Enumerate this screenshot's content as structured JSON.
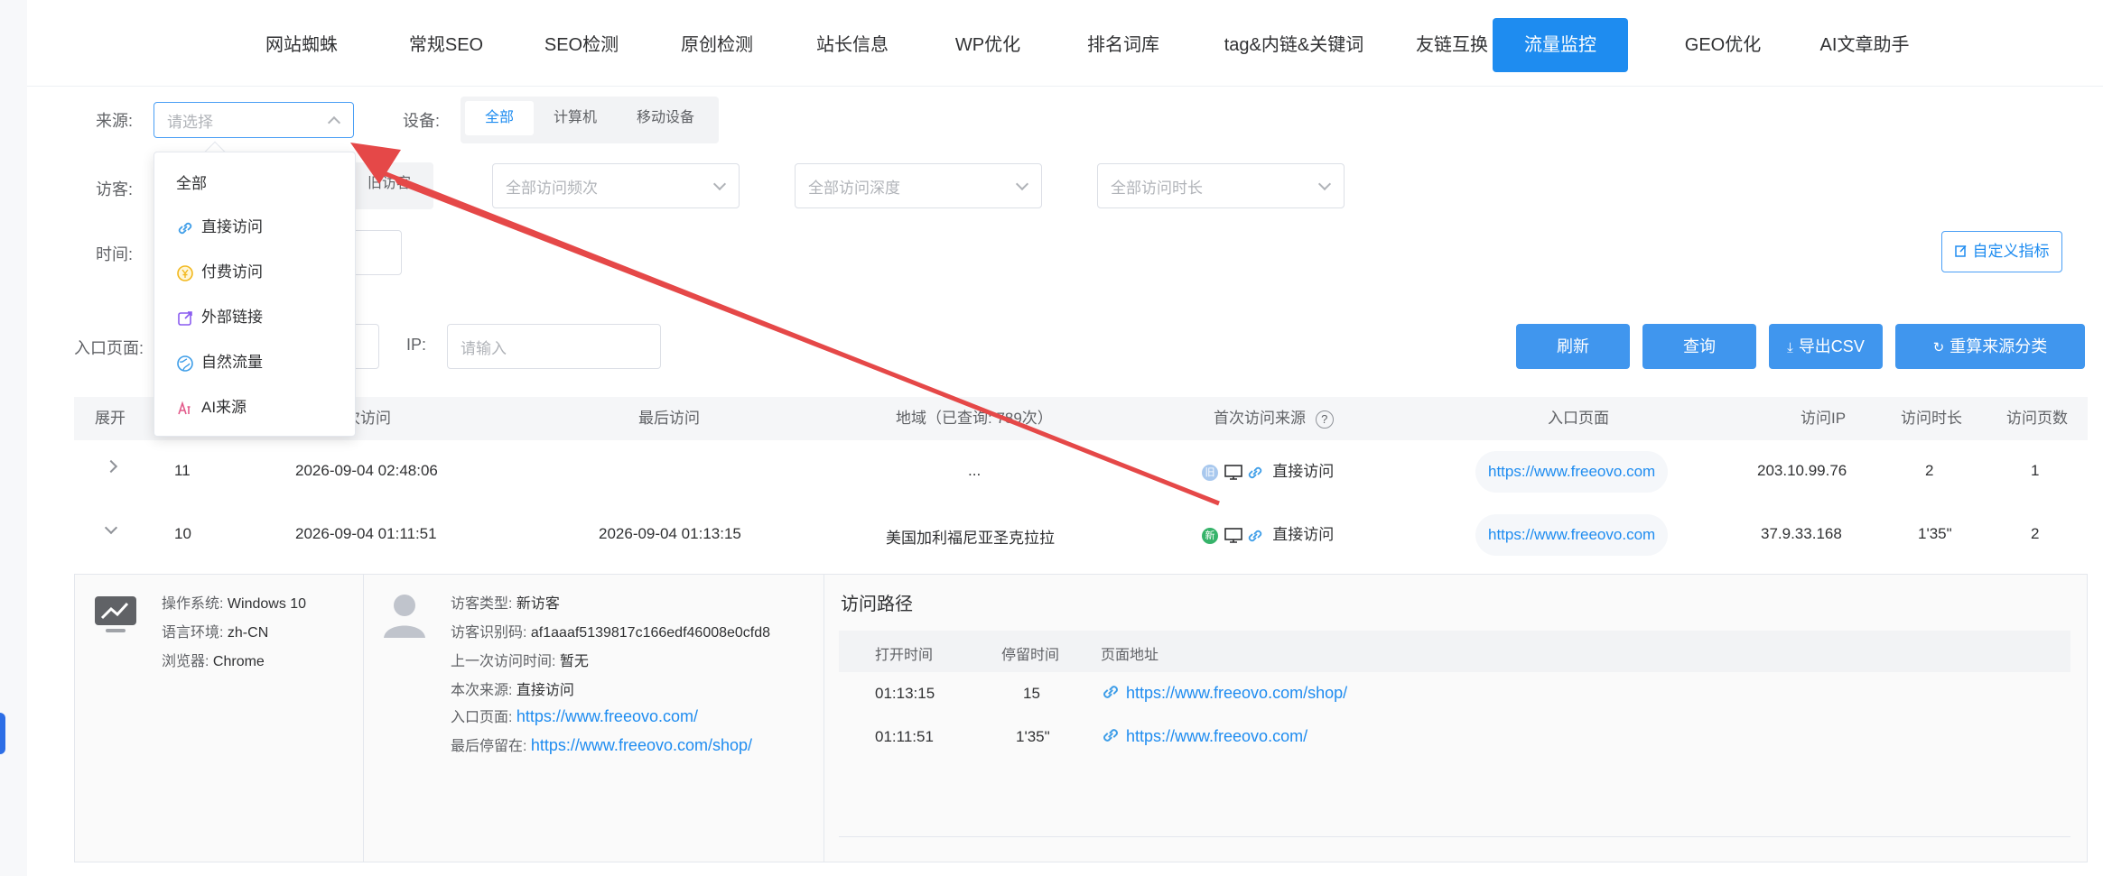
{
  "nav": {
    "items": [
      "网站蜘蛛",
      "常规SEO",
      "SEO检测",
      "原创检测",
      "站长信息",
      "WP优化",
      "排名词库",
      "tag&内链&关键词",
      "友链互换",
      "流量监控",
      "GEO优化",
      "AI文章助手"
    ],
    "active_index": 9
  },
  "filters": {
    "source_label": "来源:",
    "source_placeholder": "请选择",
    "device_label": "设备:",
    "device_options": [
      "全部",
      "计算机",
      "移动设备"
    ],
    "visitor_label": "访客:",
    "visitor_old": "旧访客",
    "freq_placeholder": "全部访问频次",
    "depth_placeholder": "全部访问深度",
    "duration_placeholder": "全部访问时长",
    "time_label": "时间:",
    "custom_metric": "自定义指标",
    "entry_label": "入口页面:",
    "ip_label": "IP:",
    "ip_placeholder": "请输入"
  },
  "buttons": {
    "refresh": "刷新",
    "query": "查询",
    "export": "导出CSV",
    "reclassify": "重算来源分类"
  },
  "dropdown": {
    "items": [
      {
        "label": "全部",
        "icon": ""
      },
      {
        "label": "直接访问",
        "icon": "link-icon"
      },
      {
        "label": "付费访问",
        "icon": "yen-coin-icon"
      },
      {
        "label": "外部链接",
        "icon": "external-link-icon"
      },
      {
        "label": "自然流量",
        "icon": "globe-icon"
      },
      {
        "label": "AI来源",
        "icon": "ai-icon"
      }
    ]
  },
  "table": {
    "headers": {
      "expand": "展开",
      "first_visit": "次访问",
      "last_visit": "最后访问",
      "region": "地域（已查询: 789次）",
      "first_source": "首次访问来源",
      "entry_page": "入口页面",
      "ip": "访问IP",
      "duration": "访问时长",
      "pages": "访问页数"
    },
    "rows": [
      {
        "id": "11",
        "first": "2026-09-04 02:48:06",
        "last": "",
        "region": "...",
        "source": "直接访问",
        "entry": "https://www.freeovo.com",
        "ip": "203.10.99.76",
        "duration": "2",
        "pages": "1",
        "badge": "旧"
      },
      {
        "id": "10",
        "first": "2026-09-04 01:11:51",
        "last": "2026-09-04 01:13:15",
        "region": "美国加利福尼亚圣克拉拉",
        "source": "直接访问",
        "entry": "https://www.freeovo.com",
        "ip": "37.9.33.168",
        "duration": "1'35\"",
        "pages": "2",
        "badge": "新"
      }
    ]
  },
  "detail": {
    "os": {
      "label": "操作系统:",
      "value": "Windows 10"
    },
    "lang": {
      "label": "语言环境:",
      "value": "zh-CN"
    },
    "browser": {
      "label": "浏览器:",
      "value": "Chrome"
    },
    "visitor_type": {
      "label": "访客类型:",
      "value": "新访客"
    },
    "visitor_id": {
      "label": "访客识别码:",
      "value": "af1aaaf5139817c166edf46008e0cfd8"
    },
    "last_time": {
      "label": "上一次访问时间:",
      "value": "暂无"
    },
    "this_source": {
      "label": "本次来源:",
      "value": "直接访问"
    },
    "entry": {
      "label": "入口页面:",
      "value": "https://www.freeovo.com/"
    },
    "last_stay": {
      "label": "最后停留在:",
      "value": "https://www.freeovo.com/shop/"
    },
    "path_title": "访问路径",
    "path_headers": [
      "打开时间",
      "停留时间",
      "页面地址"
    ],
    "path_rows": [
      {
        "time": "01:13:15",
        "stay": "15",
        "url": "https://www.freeovo.com/shop/"
      },
      {
        "time": "01:11:51",
        "stay": "1'35\"",
        "url": "https://www.freeovo.com/"
      }
    ]
  },
  "colors": {
    "accent": "#1e8cf0",
    "arrow": "#e54848"
  }
}
